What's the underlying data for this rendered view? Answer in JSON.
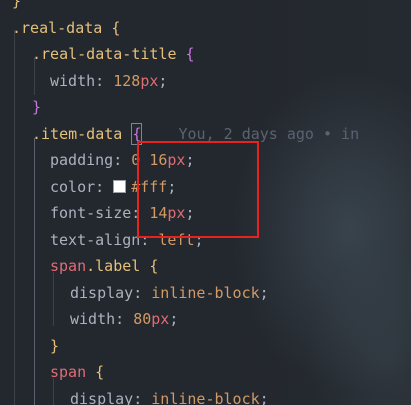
{
  "editor": {
    "lines": [
      {
        "id": "l0",
        "parts": [
          [
            "}",
            "brace-y"
          ]
        ]
      },
      {
        "id": "l1",
        "parts": [
          [
            ".real-data",
            "sel"
          ],
          [
            " ",
            "punc"
          ],
          [
            "{",
            "brace-y"
          ]
        ]
      },
      {
        "id": "l2",
        "parts": [
          [
            ".real-data-title",
            "sel"
          ],
          [
            " ",
            "punc"
          ],
          [
            "{",
            "brace"
          ]
        ]
      },
      {
        "id": "l3",
        "parts": [
          [
            "width",
            "prop"
          ],
          [
            ": ",
            "punc"
          ],
          [
            "128",
            "num"
          ],
          [
            "px",
            "tag"
          ],
          [
            ";",
            "punc"
          ]
        ]
      },
      {
        "id": "l4",
        "parts": [
          [
            "}",
            "brace"
          ]
        ]
      },
      {
        "id": "l5",
        "parts": [
          [
            ".item-data",
            "sel"
          ],
          [
            " ",
            "punc"
          ],
          [
            "{",
            "brace"
          ]
        ]
      },
      {
        "id": "l6",
        "parts": [
          [
            "padding",
            "prop"
          ],
          [
            ": ",
            "punc"
          ],
          [
            "0",
            "num"
          ],
          [
            " ",
            "punc"
          ],
          [
            "16",
            "num"
          ],
          [
            "px",
            "tag"
          ],
          [
            ";",
            "punc"
          ]
        ]
      },
      {
        "id": "l7",
        "parts": [
          [
            "color",
            "prop"
          ],
          [
            ": ",
            "punc"
          ],
          [
            "#fff",
            "num"
          ],
          [
            ";",
            "punc"
          ]
        ]
      },
      {
        "id": "l8",
        "parts": [
          [
            "font-size",
            "prop"
          ],
          [
            ": ",
            "punc"
          ],
          [
            "14",
            "num"
          ],
          [
            "px",
            "tag"
          ],
          [
            ";",
            "punc"
          ]
        ]
      },
      {
        "id": "l9",
        "parts": [
          [
            "text-align",
            "prop"
          ],
          [
            ": ",
            "punc"
          ],
          [
            "left",
            "num"
          ],
          [
            ";",
            "punc"
          ]
        ]
      },
      {
        "id": "l10",
        "parts": [
          [
            "span",
            "tag"
          ],
          [
            ".label",
            "sel"
          ],
          [
            " ",
            "punc"
          ],
          [
            "{",
            "brace-y"
          ]
        ]
      },
      {
        "id": "l11",
        "parts": [
          [
            "display",
            "prop"
          ],
          [
            ": ",
            "punc"
          ],
          [
            "inline-block",
            "num"
          ],
          [
            ";",
            "punc"
          ]
        ]
      },
      {
        "id": "l12",
        "parts": [
          [
            "width",
            "prop"
          ],
          [
            ": ",
            "punc"
          ],
          [
            "80",
            "num"
          ],
          [
            "px",
            "tag"
          ],
          [
            ";",
            "punc"
          ]
        ]
      },
      {
        "id": "l13",
        "parts": [
          [
            "}",
            "brace-y"
          ]
        ]
      },
      {
        "id": "l14",
        "parts": [
          [
            "span",
            "tag"
          ],
          [
            " ",
            "punc"
          ],
          [
            "{",
            "brace-y"
          ]
        ]
      },
      {
        "id": "l15",
        "parts": [
          [
            "display",
            "prop"
          ],
          [
            ": ",
            "punc"
          ],
          [
            "inline-block",
            "num"
          ],
          [
            ";",
            "punc"
          ]
        ]
      }
    ],
    "blame": "You, 2 days ago • in",
    "color_swatch": "#ffffff"
  },
  "colors": {
    "background": "#23272e",
    "selector": "#e5c07b",
    "unit": "#e06c75",
    "number": "#d19a66",
    "brace": "#c678dd",
    "blame": "#5c6370",
    "highlight_box": "#e8231f"
  }
}
